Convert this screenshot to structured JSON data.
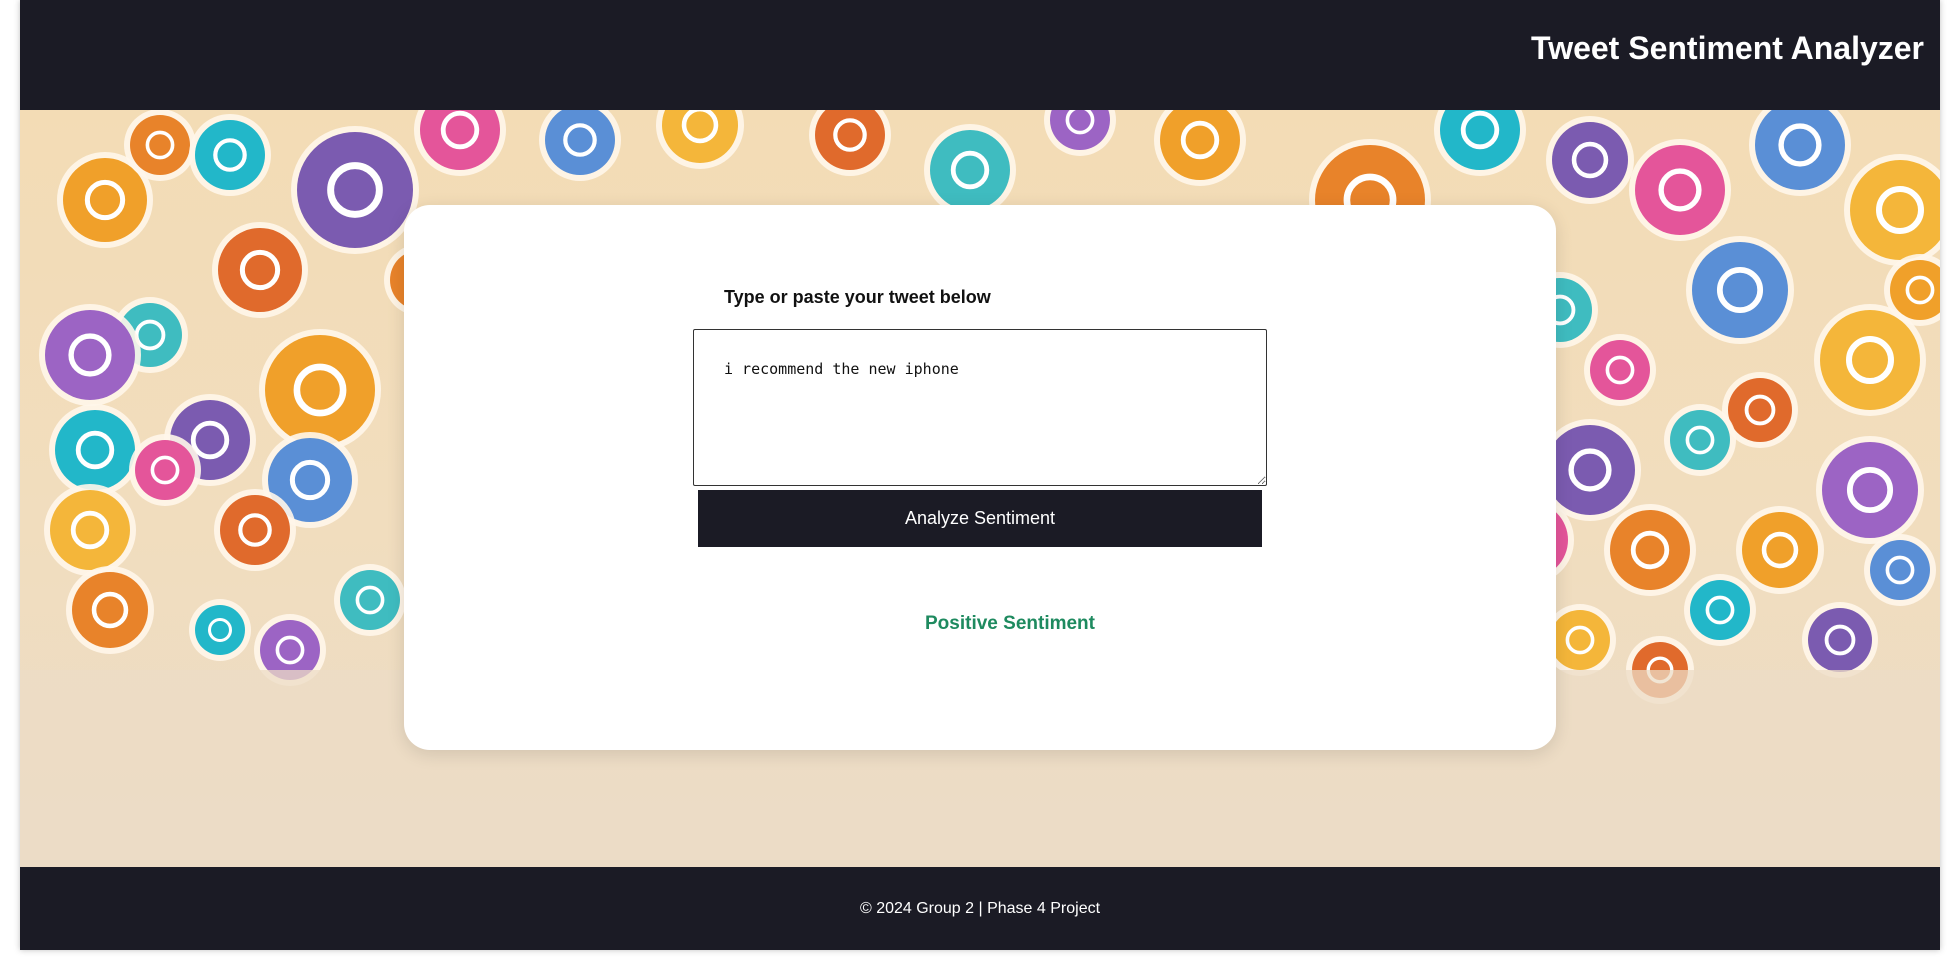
{
  "header": {
    "title": "Tweet Sentiment Analyzer"
  },
  "form": {
    "prompt_label": "Type or paste your tweet below",
    "tweet_text": "i recommend the new iphone",
    "analyze_button_label": "Analyze Sentiment"
  },
  "result": {
    "sentiment_text": "Positive Sentiment",
    "sentiment_color": "#1e8a5f"
  },
  "footer": {
    "text": "© 2024 Group 2 | Phase 4 Project"
  },
  "colors": {
    "header_bg": "#1b1b25",
    "background": "#f3dcb5"
  },
  "background_icons": [
    "twitter-icon",
    "instagram-icon",
    "heart-icon",
    "chat-icon",
    "camera-icon",
    "facebook-icon",
    "emoji-icon"
  ]
}
